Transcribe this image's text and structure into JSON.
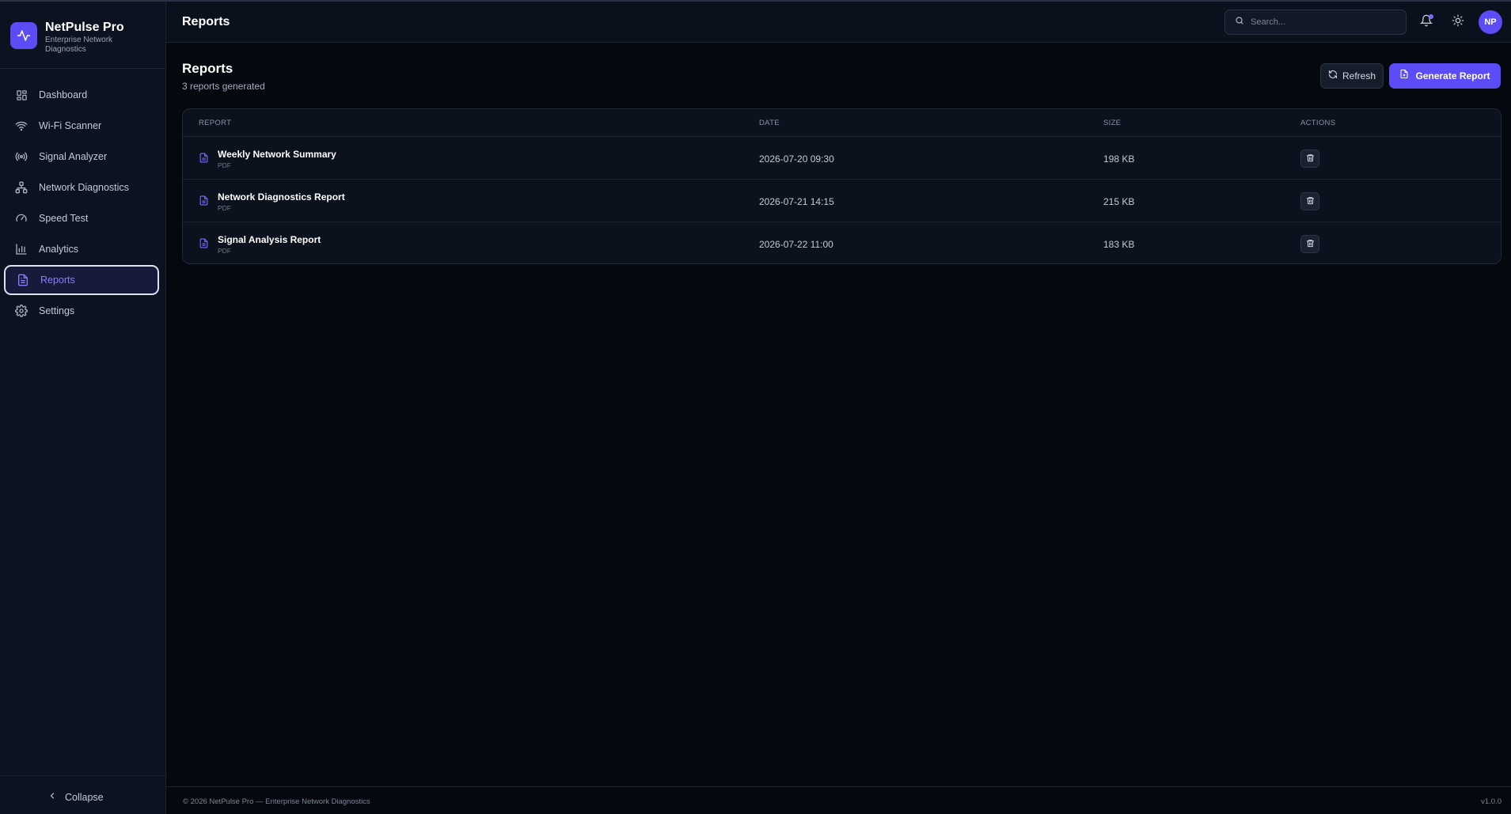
{
  "app": {
    "name": "NetPulse Pro",
    "subtitle": "Enterprise Network Diagnostics"
  },
  "sidebar": {
    "items": [
      {
        "label": "Dashboard",
        "icon": "dashboard-grid-icon"
      },
      {
        "label": "Wi-Fi Scanner",
        "icon": "wifi-icon"
      },
      {
        "label": "Signal Analyzer",
        "icon": "signal-broadcast-icon"
      },
      {
        "label": "Network Diagnostics",
        "icon": "network-topology-icon"
      },
      {
        "label": "Speed Test",
        "icon": "gauge-icon"
      },
      {
        "label": "Analytics",
        "icon": "bar-chart-icon"
      },
      {
        "label": "Reports",
        "icon": "file-text-icon",
        "active": true
      },
      {
        "label": "Settings",
        "icon": "gear-icon"
      }
    ],
    "collapse_label": "Collapse"
  },
  "topbar": {
    "title": "Reports",
    "search_placeholder": "Search...",
    "avatar_initials": "NP"
  },
  "page": {
    "title": "Reports",
    "subtitle": "3 reports generated",
    "refresh_label": "Refresh",
    "generate_label": "Generate Report"
  },
  "table": {
    "columns": {
      "report": "REPORT",
      "date": "DATE",
      "size": "SIZE",
      "actions": "ACTIONS"
    },
    "rows": [
      {
        "name": "Weekly Network Summary",
        "type": "PDF",
        "date": "2026-07-20 09:30",
        "size": "198 KB"
      },
      {
        "name": "Network Diagnostics Report",
        "type": "PDF",
        "date": "2026-07-21 14:15",
        "size": "215 KB"
      },
      {
        "name": "Signal Analysis Report",
        "type": "PDF",
        "date": "2026-07-22 11:00",
        "size": "183 KB"
      }
    ]
  },
  "footer": {
    "copyright": "© 2026 NetPulse Pro — Enterprise Network Diagnostics",
    "version": "v1.0.0"
  },
  "colors": {
    "accent": "#5b4cf5",
    "active_text": "#8a7cff",
    "background": "#05080f",
    "sidebar": "#0c1220"
  }
}
